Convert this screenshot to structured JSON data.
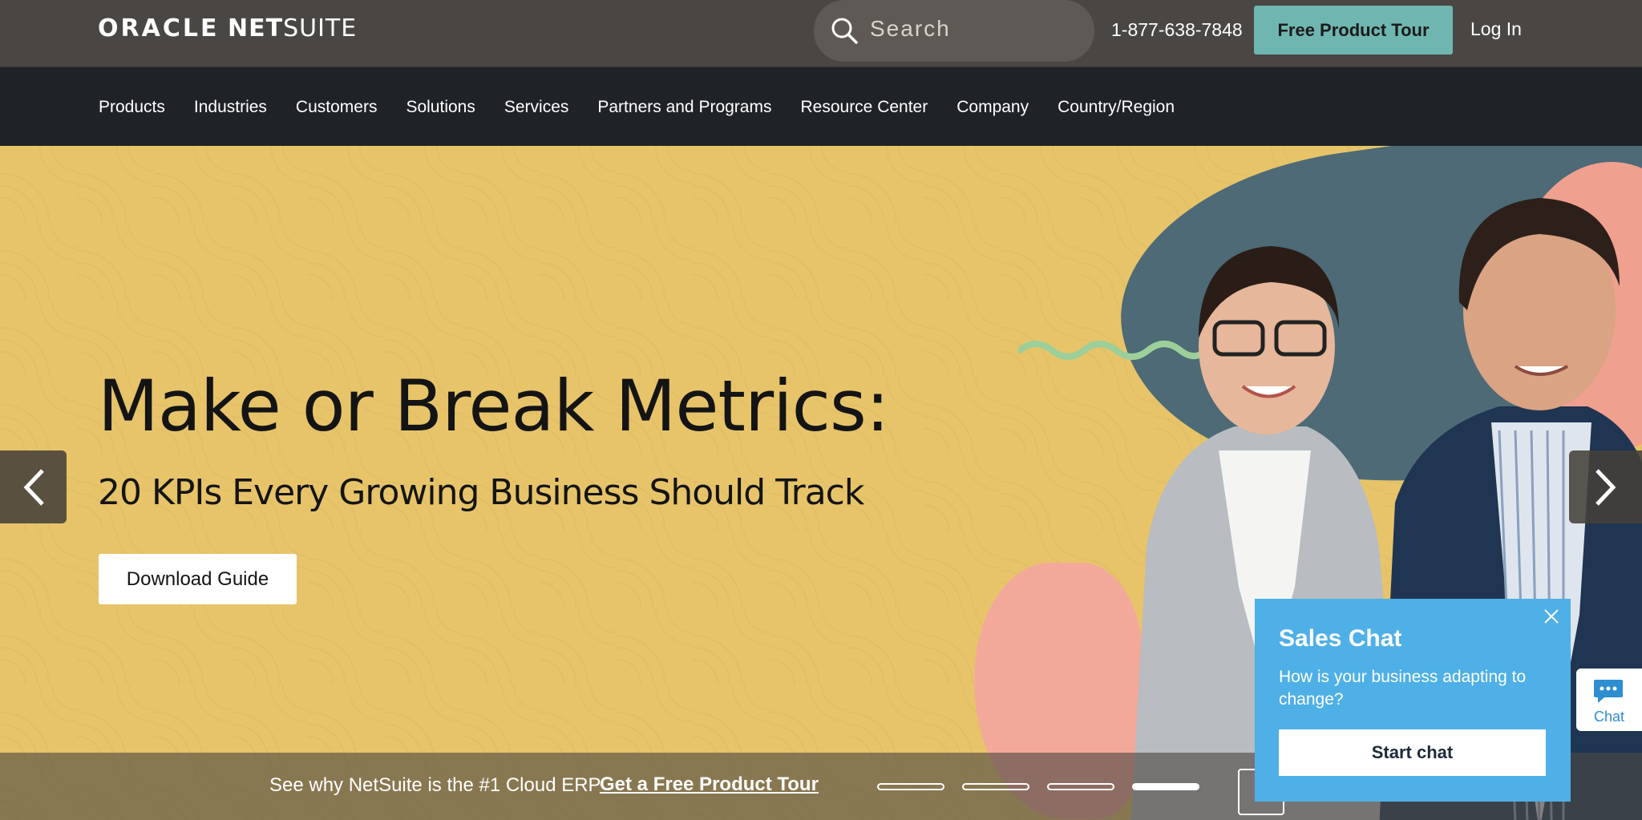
{
  "header": {
    "logo_primary": "ORACLE",
    "logo_net": "NET",
    "logo_suite": "SUITE",
    "search_placeholder": "Search",
    "phone": "1-877-638-7848",
    "tour_button": "Free Product Tour",
    "login": "Log In"
  },
  "nav": {
    "items": [
      "Products",
      "Industries",
      "Customers",
      "Solutions",
      "Services",
      "Partners and Programs",
      "Resource Center",
      "Company",
      "Country/Region"
    ]
  },
  "hero": {
    "headline": "Make or Break Metrics:",
    "subheadline": "20 KPIs Every Growing Business Should Track",
    "cta": "Download Guide"
  },
  "strip": {
    "tagline": "See why NetSuite is the #1 Cloud ERP",
    "link": "Get a Free Product Tour",
    "slide_count": 4,
    "active_slide": 4
  },
  "chat": {
    "title": "Sales Chat",
    "message": "How is your business adapting to change?",
    "button": "Start chat",
    "tab_label": "Chat"
  },
  "colors": {
    "topbar": "#4a4643",
    "nav": "#1f2328",
    "hero_bg": "#e7c46a",
    "accent_teal": "#6fb6b1",
    "chat_blue": "#4eb0e6"
  }
}
